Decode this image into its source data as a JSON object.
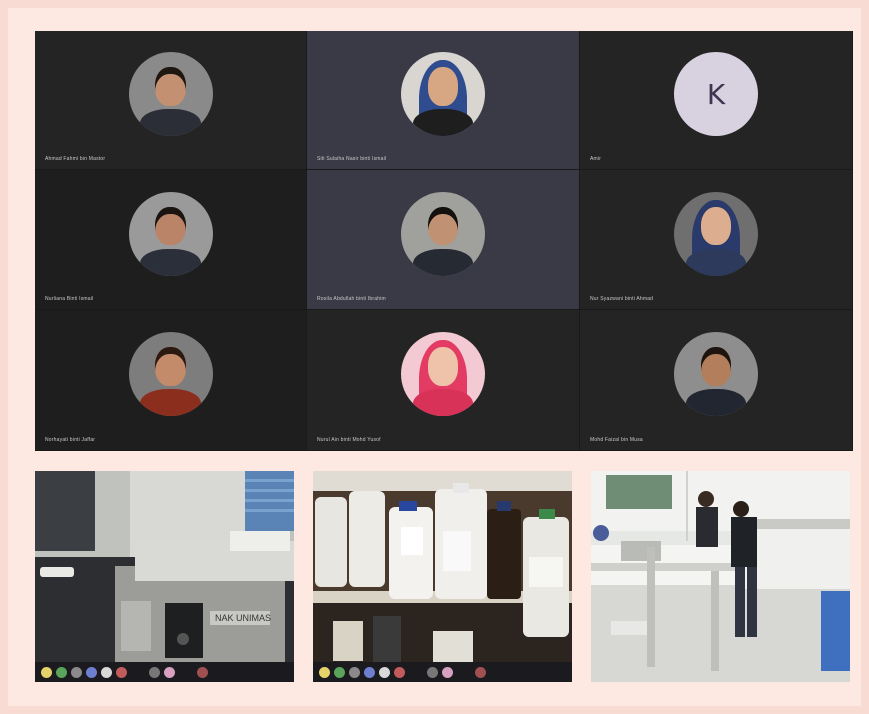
{
  "call": {
    "participants": [
      {
        "name": "Ahmad Fahmi bin Mastor",
        "kind": "photo",
        "skin": "#c49072",
        "hair": "#1f1712",
        "shirt": "#2b2e36",
        "bg": "#8a8a8a"
      },
      {
        "name": "Siti Sulaiha Nasir binti Ismail",
        "kind": "hijab",
        "skin": "#d7a784",
        "hijab": "#2f4c8e",
        "shirt": "#1e1e1e",
        "bg": "#d9d6d2"
      },
      {
        "name": "Amir",
        "kind": "initial",
        "initial": "K"
      },
      {
        "name": "Nurliana Binti Ismail",
        "kind": "photo",
        "skin": "#b98468",
        "hair": "#1b1411",
        "shirt": "#2a2f3a",
        "bg": "#9a9a9a"
      },
      {
        "name": "Rosila Abdullah binti Ibrahim",
        "kind": "photo",
        "skin": "#c19173",
        "hair": "#14100e",
        "shirt": "#262a33",
        "bg": "#a0a09c"
      },
      {
        "name": "Nur Syazwani binti Ahmad",
        "kind": "hijab",
        "skin": "#dcae8f",
        "hijab": "#2a3a6a",
        "shirt": "#2d3a5c",
        "bg": "#6f6f6f"
      },
      {
        "name": "Norhayati binti Jaffar",
        "kind": "photo",
        "skin": "#c48b6a",
        "hair": "#2c1a12",
        "shirt": "#8c2e1e",
        "bg": "#7d7d7d"
      },
      {
        "name": "Nurul Ain binti Mohd Yusof",
        "kind": "hijab",
        "skin": "#efc3a9",
        "hijab": "#e33b63",
        "shirt": "#d83258",
        "bg": "#f3c9d3"
      },
      {
        "name": "Mohd Faizal bin Musa",
        "kind": "photo",
        "skin": "#b27e5c",
        "hair": "#1d1410",
        "shirt": "#222630",
        "bg": "#8e8e8e"
      }
    ]
  },
  "photos": [
    {
      "name": "lab-equipment-photo",
      "device_label": "NAK UNIMAS"
    },
    {
      "name": "chemical-shelf-photo"
    },
    {
      "name": "laboratory-room-photo"
    }
  ],
  "colors": {
    "page_bg": "#f8dcd3",
    "call_bg": "#242424",
    "speaking_tile": "#3a3a46",
    "taskbar": "#1b1b1f"
  },
  "taskbar_icons": [
    "tb-icon",
    "tb-icon",
    "tb-icon",
    "tb-icon",
    "tb-icon",
    "tb-icon",
    "tb-icon",
    "tb-icon",
    "tb-icon"
  ]
}
